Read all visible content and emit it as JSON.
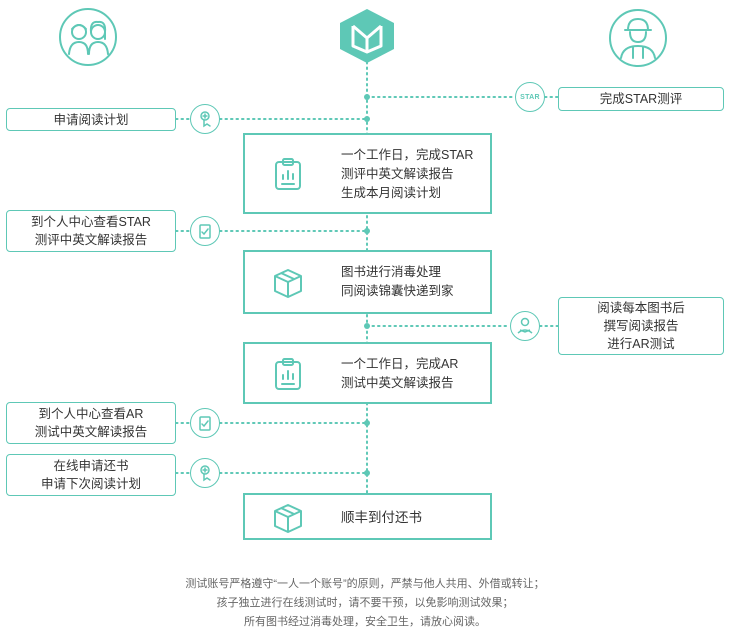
{
  "accent_color": "#5ec8b6",
  "actors": {
    "parent_icon": "parents-icon",
    "brand_icon": "brand-logo-icon",
    "courier_icon": "courier-icon"
  },
  "left_steps": [
    {
      "lines": [
        "申请阅读计划"
      ],
      "icon": "click-hand-icon"
    },
    {
      "lines": [
        "到个人中心查看STAR",
        "测评中英文解读报告"
      ],
      "icon": "report-check-icon"
    },
    {
      "lines": [
        "到个人中心查看AR",
        "测试中英文解读报告"
      ],
      "icon": "report-check-icon"
    },
    {
      "lines": [
        "在线申请还书",
        "申请下次阅读计划"
      ],
      "icon": "click-hand-icon"
    }
  ],
  "right_steps": [
    {
      "lines": [
        "完成STAR测评"
      ],
      "icon": "star-tag-icon",
      "tag": "STAR"
    },
    {
      "lines": [
        "阅读每本图书后",
        "撰写阅读报告",
        "进行AR测试"
      ],
      "icon": "reader-icon"
    }
  ],
  "center_steps": [
    {
      "lines": [
        "一个工作日，完成STAR",
        "测评中英文解读报告",
        "生成本月阅读计划"
      ],
      "icon": "clipboard-chart-icon"
    },
    {
      "lines": [
        "图书进行消毒处理",
        "同阅读锦囊快递到家"
      ],
      "icon": "package-icon"
    },
    {
      "lines": [
        "一个工作日，完成AR",
        "测试中英文解读报告"
      ],
      "icon": "clipboard-chart-icon"
    },
    {
      "lines": [
        "顺丰到付还书"
      ],
      "icon": "package-icon"
    }
  ],
  "footer": [
    "测试账号严格遵守“一人一个账号”的原则，严禁与他人共用、外借或转让；",
    "孩子独立进行在线测试时，请不要干预，以免影响测试效果；",
    "所有图书经过消毒处理，安全卫生，请放心阅读。"
  ]
}
